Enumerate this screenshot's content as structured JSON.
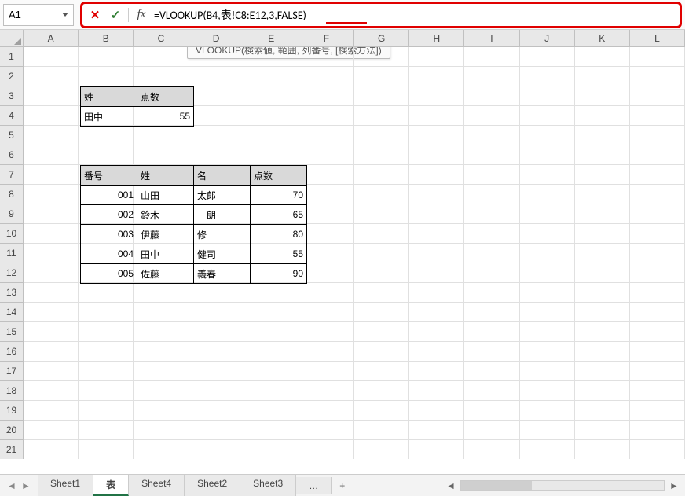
{
  "name_box": "A1",
  "formula": "=VLOOKUP(B4,表!C8:E12,3,FALSE)",
  "tooltip": "VLOOKUP(検索値, 範囲, 列番号, [検索方法])",
  "columns": [
    "A",
    "B",
    "C",
    "D",
    "E",
    "F",
    "G",
    "H",
    "I",
    "J",
    "K",
    "L"
  ],
  "row_count": 21,
  "table1": {
    "headers": [
      "姓",
      "点数"
    ],
    "rows": [
      [
        "田中",
        "55"
      ]
    ]
  },
  "table2": {
    "headers": [
      "番号",
      "姓",
      "名",
      "点数"
    ],
    "rows": [
      [
        "001",
        "山田",
        "太郎",
        "70"
      ],
      [
        "002",
        "鈴木",
        "一朗",
        "65"
      ],
      [
        "003",
        "伊藤",
        "修",
        "80"
      ],
      [
        "004",
        "田中",
        "健司",
        "55"
      ],
      [
        "005",
        "佐藤",
        "義春",
        "90"
      ]
    ]
  },
  "tabs": [
    "Sheet1",
    "表",
    "Sheet4",
    "Sheet2",
    "Sheet3"
  ],
  "active_tab": "表",
  "icons": {
    "cancel": "✕",
    "confirm": "✓",
    "fx": "fx",
    "dropdown": "",
    "left": "◄",
    "right": "►",
    "ellipsis": "…",
    "plus": "+"
  }
}
